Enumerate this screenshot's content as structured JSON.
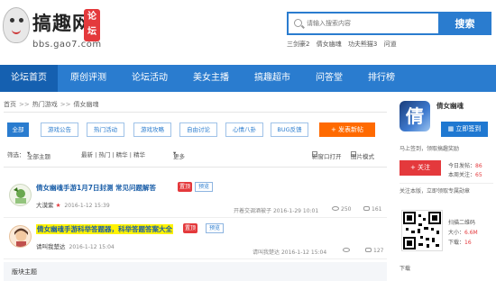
{
  "header": {
    "brand": "搞趣网",
    "seal": "论坛",
    "domain": "bbs.gao7.com",
    "search_placeholder": "请输入搜索内容",
    "search_button": "搜索",
    "hot_keywords": [
      "三剑豪2",
      "倩女幽魂",
      "功夫熊猫3",
      "问道"
    ]
  },
  "nav": {
    "items": [
      {
        "label": "论坛首页",
        "active": true
      },
      {
        "label": "原创评测",
        "active": false
      },
      {
        "label": "论坛活动",
        "active": false
      },
      {
        "label": "美女主播",
        "active": false
      },
      {
        "label": "搞趣超市",
        "active": false
      },
      {
        "label": "问答堂",
        "active": false
      },
      {
        "label": "排行榜",
        "active": false
      }
    ]
  },
  "breadcrumb": {
    "home": "首页",
    "sep": ">>",
    "section": "热门游戏",
    "current": "倩女幽魂"
  },
  "tabs": [
    {
      "label": "全部",
      "active": true
    },
    {
      "label": "游戏公告",
      "active": false
    },
    {
      "label": "热门活动",
      "active": false
    },
    {
      "label": "游戏攻略",
      "active": false
    },
    {
      "label": "自由讨论",
      "active": false
    },
    {
      "label": "心情八卦",
      "active": false
    },
    {
      "label": "BUG反馈",
      "active": false
    }
  ],
  "post_button": "+ 发表新帖",
  "filter": {
    "label": "筛选：",
    "all_topics": "全部主题",
    "sorts": "最新 | 热门 | 精华 | 精华",
    "more": "更多",
    "new_window": "新窗口打开",
    "image_mode": "图片模式"
  },
  "threads": [
    {
      "title": "倩女幽魂手游1月7日封测 常见问题解答",
      "highlight": false,
      "badge": "置顶",
      "preview": "预览",
      "author": "大漠紫",
      "date": "2016-1-12 15:39",
      "last_reply": "开着交调酒被子",
      "last_date": "2016-1-29 10:01",
      "views": "250",
      "replies": "161"
    },
    {
      "title": "倩女幽魂手游科举答题器，科举答题答案大全",
      "highlight": true,
      "badge": "置顶",
      "preview": "预览",
      "author": "请叫我楚达",
      "date": "2016-1-12 15:04",
      "last_reply": "请叫我楚达",
      "last_date": "2016-1-12 15:04",
      "views": "",
      "replies": "127"
    }
  ],
  "section_title": "版块主题",
  "sidebar": {
    "game_name": "倩女幽魂",
    "icon_char": "倩",
    "signin_button": "立即签到",
    "signin_note": "马上签到，领取搞趣奖励",
    "follow_button": "+ 关注",
    "today_posts_label": "今日发帖：",
    "today_posts": "86",
    "total_follow_label": "本周关注：",
    "total_follow": "65",
    "follow_note": "关注本版，立即领取专属勋章",
    "scan_label": "扫描二维码",
    "size_label": "大小：",
    "size": "6.6M",
    "download_label": "下载：",
    "download_count": "16",
    "bottom_note": "下载"
  },
  "colors": {
    "brand_blue": "#2a7ccf",
    "accent_orange": "#ff6a00",
    "red": "#e4393c"
  }
}
